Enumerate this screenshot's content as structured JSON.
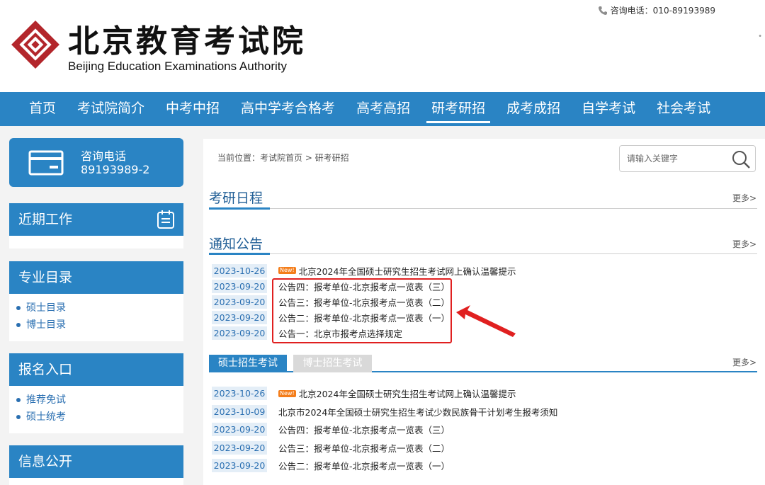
{
  "header": {
    "logo_cn": "北京教育考试院",
    "logo_en": "Beijing Education Examinations Authority",
    "hotline": "咨询电话：010-89193989",
    "dots": "•"
  },
  "nav": [
    "首页",
    "考试院简介",
    "中考中招",
    "高中学考合格考",
    "高考高招",
    "研考研招",
    "成考成招",
    "自学考试",
    "社会考试"
  ],
  "nav_active": "研考研招",
  "sidebar": {
    "hotline_title": "咨询电话",
    "hotline_number": "89193989-2",
    "recent_work": "近期工作",
    "catalog": {
      "title": "专业目录",
      "items": [
        "硕士目录",
        "博士目录"
      ]
    },
    "signup": {
      "title": "报名入口",
      "items": [
        "推荐免试",
        "硕士统考"
      ]
    },
    "info": {
      "title": "信息公开"
    }
  },
  "main": {
    "breadcrumb": "当前位置：考试院首页 > 研考研招",
    "search_placeholder": "请输入关键字",
    "schedule_title": "考研日程",
    "notice_title": "通知公告",
    "more": "更多>",
    "new_badge": "New!",
    "notices": [
      {
        "date": "2023-10-26",
        "title": "北京2024年全国硕士研究生招生考试网上确认温馨提示",
        "is_new": true
      },
      {
        "date": "2023-09-20",
        "title": "公告四：报考单位-北京报考点一览表（三）",
        "is_new": false
      },
      {
        "date": "2023-09-20",
        "title": "公告三：报考单位-北京报考点一览表（二）",
        "is_new": false
      },
      {
        "date": "2023-09-20",
        "title": "公告二：报考单位-北京报考点一览表（一）",
        "is_new": false
      },
      {
        "date": "2023-09-20",
        "title": "公告一：北京市报考点选择规定",
        "is_new": false
      }
    ],
    "tabs": [
      "硕士招生考试",
      "博士招生考试"
    ],
    "tab_list": [
      {
        "date": "2023-10-26",
        "title": "北京2024年全国硕士研究生招生考试网上确认温馨提示",
        "is_new": true
      },
      {
        "date": "2023-10-09",
        "title": "北京市2024年全国硕士研究生招生考试少数民族骨干计划考生报考须知",
        "is_new": false
      },
      {
        "date": "2023-09-20",
        "title": "公告四：报考单位-北京报考点一览表（三）",
        "is_new": false
      },
      {
        "date": "2023-09-20",
        "title": "公告三：报考单位-北京报考点一览表（二）",
        "is_new": false
      },
      {
        "date": "2023-09-20",
        "title": "公告二：报考单位-北京报考点一览表（一）",
        "is_new": false
      }
    ]
  },
  "colors": {
    "primary": "#2a84c4",
    "highlight": "#e02020",
    "badge": "#f47d1a",
    "logo_red": "#b3262b"
  }
}
